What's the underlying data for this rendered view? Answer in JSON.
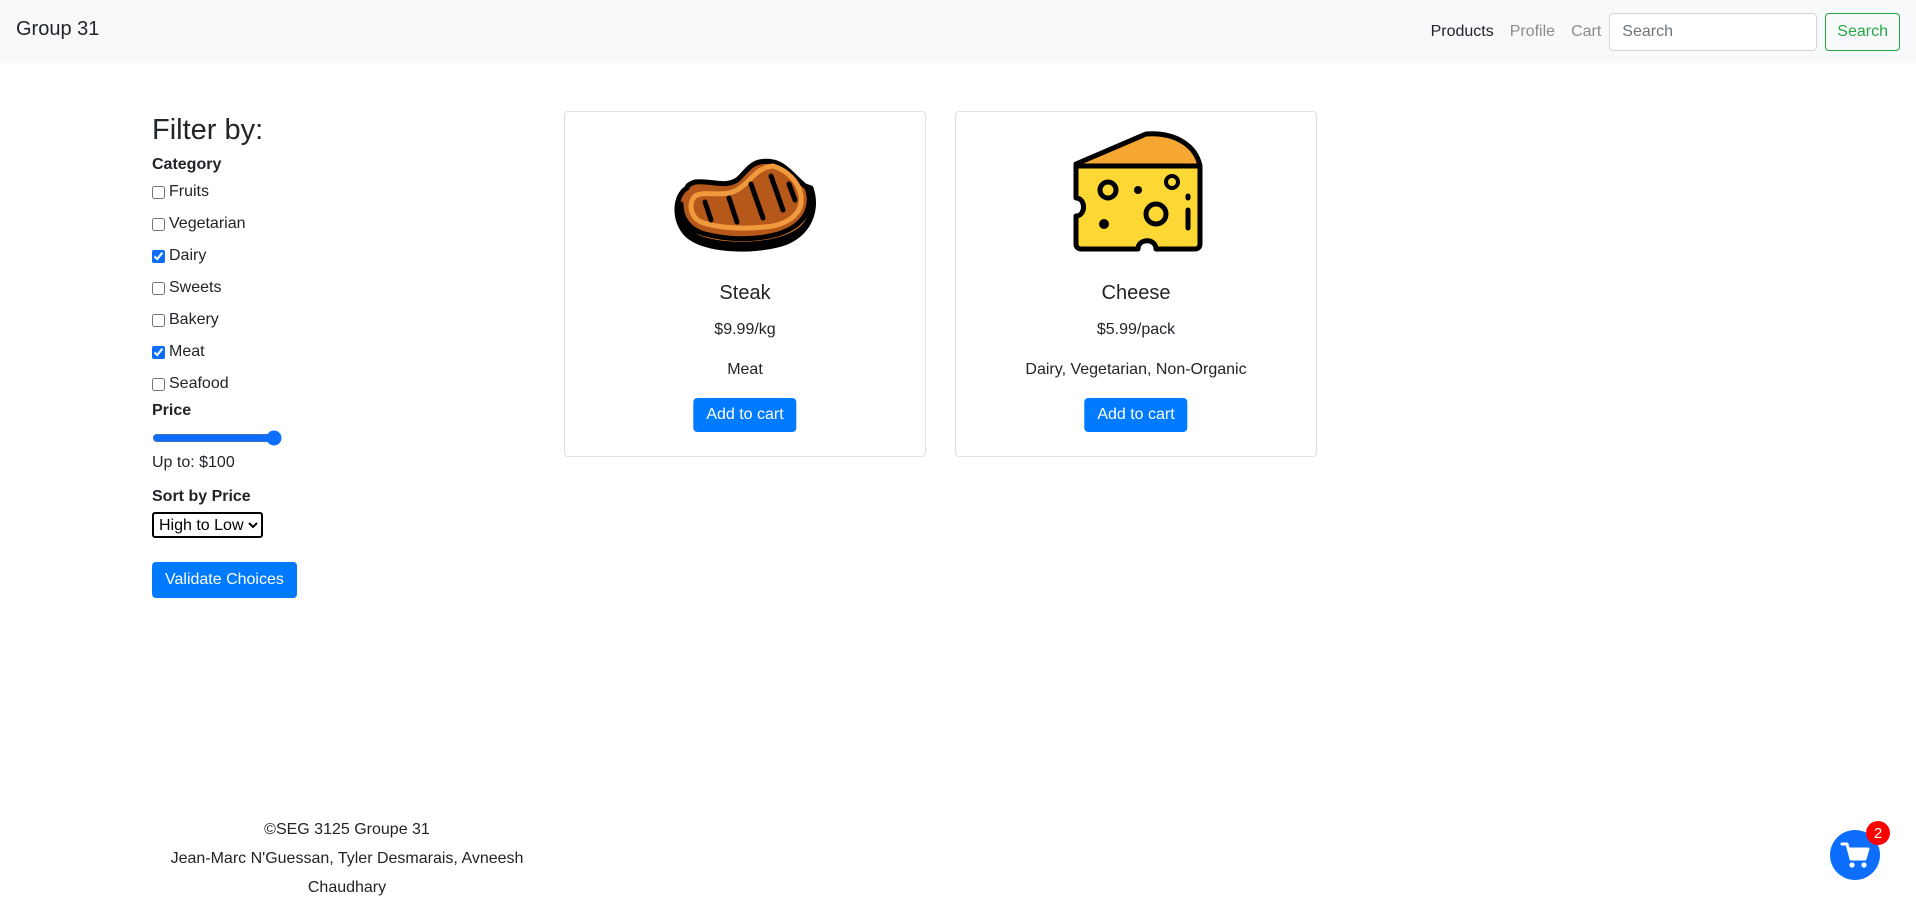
{
  "nav": {
    "brand": "Group 31",
    "links": [
      "Products",
      "Profile",
      "Cart"
    ],
    "search_placeholder": "Search",
    "search_button": "Search"
  },
  "filter": {
    "title": "Filter by:",
    "category_label": "Category",
    "categories": [
      {
        "label": "Fruits",
        "checked": false
      },
      {
        "label": "Vegetarian",
        "checked": false
      },
      {
        "label": "Dairy",
        "checked": true
      },
      {
        "label": "Sweets",
        "checked": false
      },
      {
        "label": "Bakery",
        "checked": false
      },
      {
        "label": "Meat",
        "checked": true
      },
      {
        "label": "Seafood",
        "checked": false
      }
    ],
    "price_label": "Price",
    "price_slider_value": 100,
    "price_text": "Up to: $100",
    "sort_label": "Sort by Price",
    "sort_selected": "High to Low",
    "validate_button": "Validate Choices"
  },
  "products": [
    {
      "name": "Steak",
      "price": "$9.99/kg",
      "tags": "Meat",
      "button": "Add to cart",
      "icon": "steak-icon"
    },
    {
      "name": "Cheese",
      "price": "$5.99/pack",
      "tags": "Dairy, Vegetarian, Non-Organic",
      "button": "Add to cart",
      "icon": "cheese-icon"
    }
  ],
  "footer": {
    "copyright": "©SEG 3125 Groupe 31",
    "authors": "Jean-Marc N'Guessan, Tyler Desmarais, Avneesh Chaudhary"
  },
  "cart_fab": {
    "count": "2",
    "icon": "cart-icon"
  },
  "colors": {
    "primary": "#007bff",
    "success": "#28a745",
    "badge": "#ff0000",
    "navbar_bg": "#f8f9fa"
  }
}
